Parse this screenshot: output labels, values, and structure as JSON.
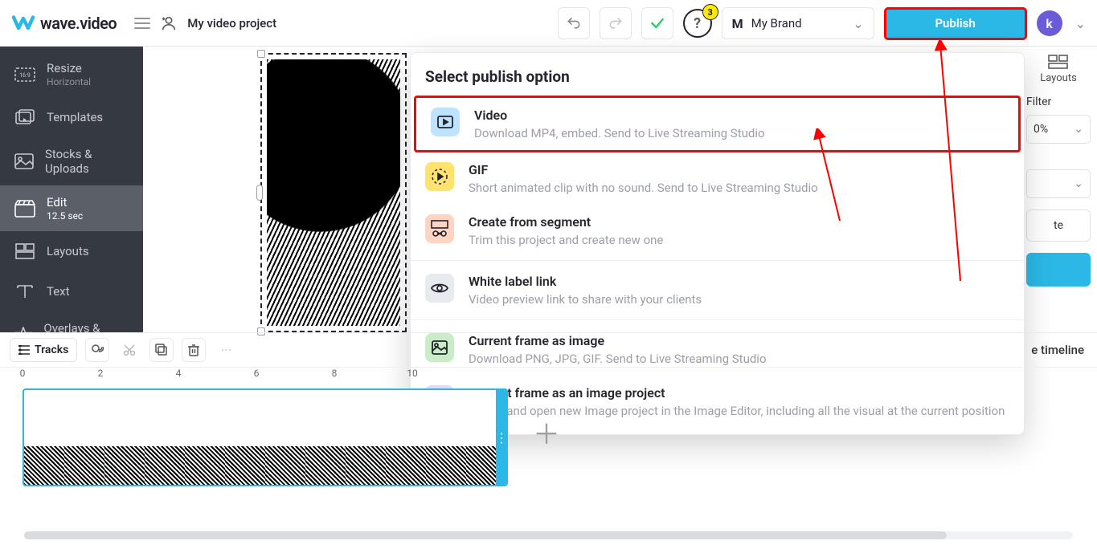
{
  "header": {
    "logo_text": "wave.video",
    "project_title": "My video project",
    "help_badge": "3",
    "brand_label": "My Brand",
    "brand_letter": "M",
    "publish_label": "Publish",
    "avatar_letter": "k"
  },
  "sidebar": {
    "items": [
      {
        "label": "Resize",
        "sub": "Horizontal",
        "icon": "resize"
      },
      {
        "label": "Templates",
        "sub": "",
        "icon": "templates"
      },
      {
        "label": "Stocks & Uploads",
        "sub": "",
        "icon": "stocks"
      },
      {
        "label": "Edit",
        "sub": "12.5 sec",
        "icon": "edit",
        "active": true
      },
      {
        "label": "Layouts",
        "sub": "",
        "icon": "layouts"
      },
      {
        "label": "Text",
        "sub": "",
        "icon": "text"
      },
      {
        "label": "Overlays & Stickers",
        "sub": "",
        "icon": "overlays"
      }
    ]
  },
  "right_panel": {
    "layouts_label": "Layouts",
    "filter_label": "Filter",
    "opacity_value": "0%",
    "btn_a": "te",
    "timeline_link": "e timeline"
  },
  "popover": {
    "title": "Select publish option",
    "items": [
      {
        "title": "Video",
        "sub": "Download MP4, embed. Send to Live Streaming Studio",
        "icon": "blue"
      },
      {
        "title": "GIF",
        "sub": "Short animated clip with no sound. Send to Live Streaming Studio",
        "icon": "yellow"
      },
      {
        "title": "Create from segment",
        "sub": "Trim this project and create new one",
        "icon": "orange"
      },
      {
        "title": "White label link",
        "sub": "Video preview link to share with your clients",
        "icon": "gray"
      },
      {
        "title": "Current frame as image",
        "sub": "Download PNG, JPG, GIF. Send to Live Streaming Studio",
        "icon": "green"
      },
      {
        "title": "Current frame as an image project",
        "sub": "Create and open new Image project in the Image Editor, including all the visual at the current position",
        "icon": "purple"
      }
    ]
  },
  "timeline": {
    "tracks_label": "Tracks",
    "ruler": [
      "0",
      "2",
      "4",
      "6",
      "8",
      "10"
    ]
  }
}
